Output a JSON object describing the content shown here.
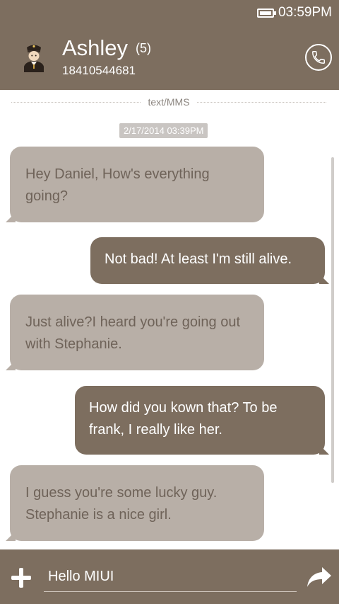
{
  "status_bar": {
    "time": "03:59PM",
    "battery_icon": "battery-full-icon"
  },
  "header": {
    "name": "Ashley",
    "unread": "(5)",
    "number": "18410544681",
    "avatar_icon": "police-officer-avatar",
    "call_icon": "phone-icon"
  },
  "thread": {
    "type_label": "text/MMS",
    "timestamp": "2/17/2014 03:39PM",
    "messages": [
      {
        "direction": "in",
        "text": "Hey Daniel, How's everything going?"
      },
      {
        "direction": "out",
        "text": "Not bad! At least I'm still alive."
      },
      {
        "direction": "in",
        "text": "Just  alive?I heard you're going out with Stephanie."
      },
      {
        "direction": "out",
        "text": "How did you kown that? To be frank, I really like her."
      },
      {
        "direction": "in",
        "text": "I guess you're some lucky guy. Stephanie is a nice girl."
      }
    ]
  },
  "composer": {
    "value": "Hello MIUI",
    "add_icon": "plus-icon",
    "send_icon": "send-arrow-icon"
  },
  "colors": {
    "brand": "#7d6e5f",
    "incoming_bubble": "#b8afa7",
    "incoming_text": "#6f6359",
    "outgoing_bubble": "#7d6e5f"
  }
}
